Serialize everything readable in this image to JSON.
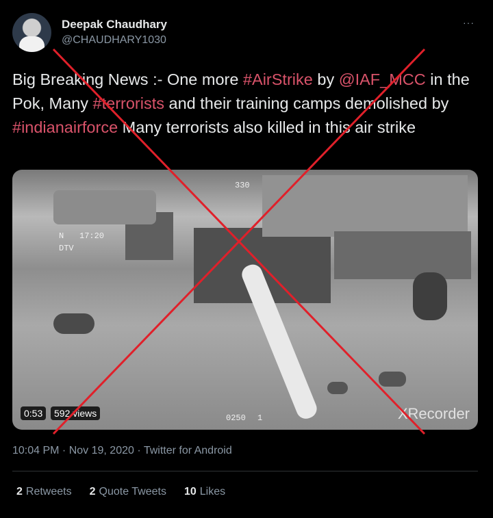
{
  "author": {
    "name": "Deepak Chaudhary",
    "handle": "@CHAUDHARY1030"
  },
  "more_icon": "···",
  "tweet": {
    "parts": [
      {
        "text": "Big Breaking News :- One more ",
        "tag": false
      },
      {
        "text": "#AirStrike",
        "tag": true
      },
      {
        "text": " by ",
        "tag": false
      },
      {
        "text": "@IAF_MCC",
        "tag": true
      },
      {
        "text": " in the Pok, Many ",
        "tag": false
      },
      {
        "text": "#terrorists",
        "tag": true
      },
      {
        "text": " and their training camps demolished by ",
        "tag": false
      },
      {
        "text": "#indianairforce",
        "tag": true
      },
      {
        "text": " Many terrorists also killed in this air strike",
        "tag": false
      }
    ]
  },
  "video": {
    "duration": "0:53",
    "views": "592 views",
    "watermark": "XRecorder",
    "hud": {
      "heading": "330",
      "left_n": "N",
      "left_time": "17:20",
      "left_mode": "DTV",
      "bottom_code": "0250",
      "bottom_num": "1"
    }
  },
  "meta": "10:04 PM · Nov 19, 2020 · Twitter for Android",
  "stats": {
    "retweets_count": "2",
    "retweets_label": "Retweets",
    "quotes_count": "2",
    "quotes_label": "Quote Tweets",
    "likes_count": "10",
    "likes_label": "Likes"
  },
  "colors": {
    "background": "#000000",
    "hashtag": "#d9536a",
    "cross": "#e0202a",
    "muted": "#8b98a5"
  }
}
